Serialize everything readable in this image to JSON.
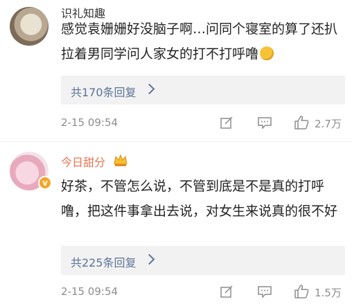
{
  "comments": [
    {
      "username": "识礼知趣",
      "text": "感觉袁姗姗好没脑子啊…问同个寝室的算了还扒拉着男同学问人家女的打不打呼噜",
      "emoji": "smile-sweat-emoji",
      "replies_label": "共170条回复",
      "time": "2-15 09:54",
      "likes": "2.7万"
    },
    {
      "username": "今日甜分",
      "badge": "v",
      "text": "好茶，不管怎么说，不管到底是不是真的打呼噜，把这件事拿出去说，对女生来说真的很不好",
      "replies_label": "共225条回复",
      "time": "2-15 09:54",
      "likes": "1.5万"
    }
  ],
  "colors": {
    "link": "#5a7398",
    "username_vip": "#eb7350",
    "meta": "#8c8c8c",
    "replies_bg": "#f2f2f2"
  }
}
